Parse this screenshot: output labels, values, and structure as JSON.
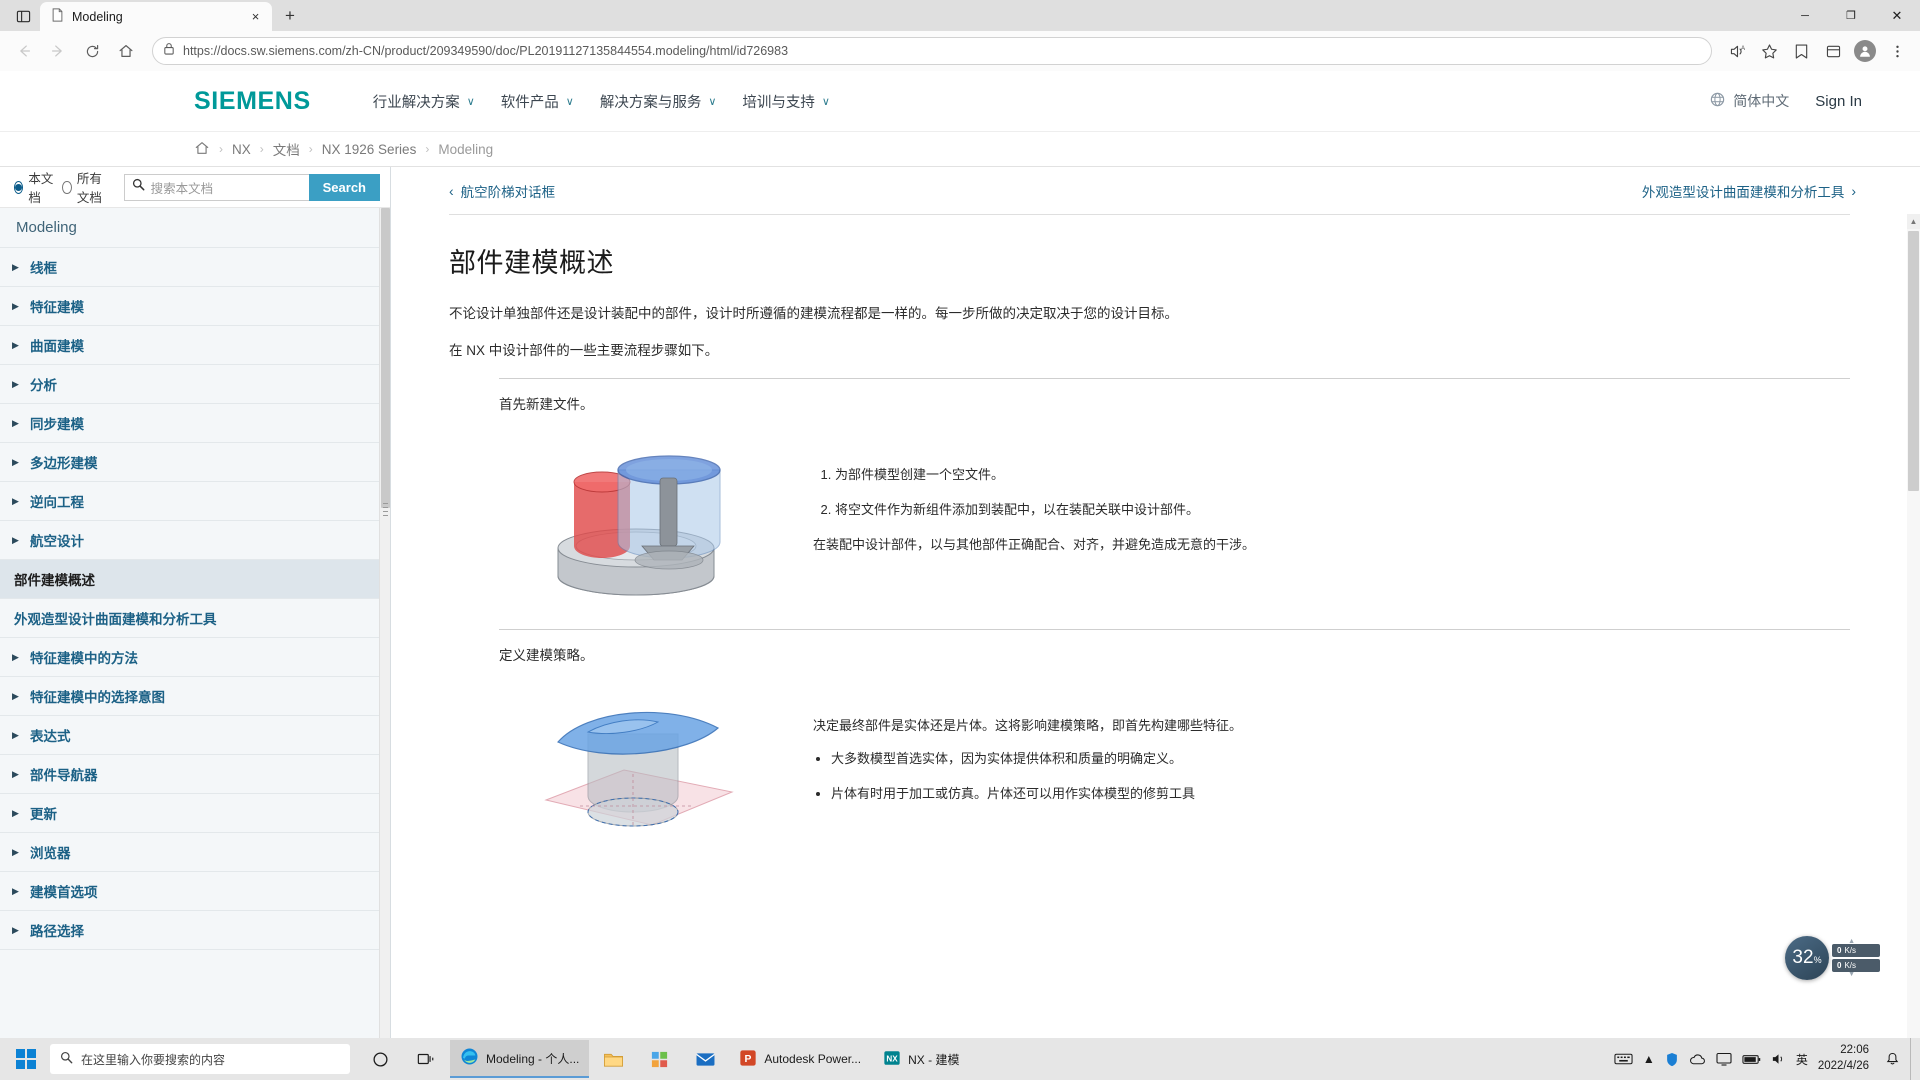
{
  "browser": {
    "tab": {
      "title": "Modeling",
      "close_label": "×",
      "favicon": "page-icon"
    },
    "newtab_label": "+",
    "window_controls": {
      "minimize": "─",
      "maximize": "❐",
      "close": "✕"
    },
    "nav": {
      "back": "←",
      "forward": "→",
      "reload": "↻",
      "home": "⌂"
    },
    "address": {
      "lock_icon": "lock-icon",
      "url_prefix": "https://",
      "url_domain": "docs.sw.siemens.com",
      "url_path": "/zh-CN/product/209349590/doc/PL20191127135844554.modeling/html/id726983",
      "url_full": "https://docs.sw.siemens.com/zh-CN/product/209349590/doc/PL20191127135844554.modeling/html/id726983"
    },
    "toolbar_icons": [
      "read-aloud-icon",
      "favorite-star-icon",
      "favorites-icon",
      "collections-icon",
      "profile-avatar-icon"
    ]
  },
  "site_header": {
    "logo": "SIEMENS",
    "nav": [
      {
        "label": "行业解决方案",
        "caret": "∨"
      },
      {
        "label": "软件产品",
        "caret": "∨"
      },
      {
        "label": "解决方案与服务",
        "caret": "∨"
      },
      {
        "label": "培训与支持",
        "caret": "∨"
      }
    ],
    "language": "简体中文",
    "sign_in": "Sign In"
  },
  "breadcrumb": {
    "home_icon": "home-icon",
    "separator": "›",
    "items": [
      "NX",
      "文档",
      "NX 1926 Series",
      "Modeling"
    ]
  },
  "search_panel": {
    "scope_current": "本文档",
    "scope_all": "所有文档",
    "scope_selected": "本文档",
    "input_value": "",
    "placeholder": "搜索本文档",
    "button_label": "Search",
    "search_icon": "search-icon",
    "accent_color": "#3b9fc4"
  },
  "toc": {
    "heading": "Modeling",
    "items": [
      {
        "label": "线框",
        "expandable": true,
        "active": false
      },
      {
        "label": "特征建模",
        "expandable": true,
        "active": false
      },
      {
        "label": "曲面建模",
        "expandable": true,
        "active": false
      },
      {
        "label": "分析",
        "expandable": true,
        "active": false
      },
      {
        "label": "同步建模",
        "expandable": true,
        "active": false
      },
      {
        "label": "多边形建模",
        "expandable": true,
        "active": false
      },
      {
        "label": "逆向工程",
        "expandable": true,
        "active": false
      },
      {
        "label": "航空设计",
        "expandable": true,
        "active": false
      },
      {
        "label": "部件建模概述",
        "expandable": false,
        "active": true
      },
      {
        "label": "外观造型设计曲面建模和分析工具",
        "expandable": false,
        "active": false
      },
      {
        "label": "特征建模中的方法",
        "expandable": true,
        "active": false
      },
      {
        "label": "特征建模中的选择意图",
        "expandable": true,
        "active": false
      },
      {
        "label": "表达式",
        "expandable": true,
        "active": false
      },
      {
        "label": "部件导航器",
        "expandable": true,
        "active": false
      },
      {
        "label": "更新",
        "expandable": true,
        "active": false
      },
      {
        "label": "浏览器",
        "expandable": true,
        "active": false
      },
      {
        "label": "建模首选项",
        "expandable": true,
        "active": false
      },
      {
        "label": "路径选择",
        "expandable": true,
        "active": false
      }
    ],
    "arrow_glyph": "▶"
  },
  "topic_nav": {
    "prev_chevron": "‹",
    "prev_label": "航空阶梯对话框",
    "next_label": "外观造型设计曲面建模和分析工具",
    "next_chevron": "›"
  },
  "article": {
    "title": "部件建模概述",
    "intro_1": "不论设计单独部件还是设计装配中的部件，设计时所遵循的建模流程都是一样的。每一步所做的决定取决于您的设计目标。",
    "intro_2": "在 NX 中设计部件的一些主要流程步骤如下。",
    "steps": [
      {
        "caption": "首先新建文件。",
        "figure": "assembly-render-figure",
        "ordered": [
          "为部件模型创建一个空文件。",
          "将空文件作为新组件添加到装配中，以在装配关联中设计部件。"
        ],
        "note": "在装配中设计部件，以与其他部件正确配合、对齐，并避免造成无意的干涉。",
        "bullets": []
      },
      {
        "caption": "定义建模策略。",
        "figure": "surface-sheet-figure",
        "ordered": [],
        "note": "决定最终部件是实体还是片体。这将影响建模策略，即首先构建哪些特征。",
        "bullets": [
          "大多数模型首选实体，因为实体提供体积和质量的明确定义。",
          "片体有时用于加工或仿真。片体还可以用作实体模型的修剪工具"
        ]
      }
    ]
  },
  "speed_widget": {
    "value": "32",
    "unit": "%",
    "up_rate": "0",
    "up_unit": "K/s",
    "down_rate": "0",
    "down_unit": "K/s",
    "caret_up": "▲",
    "caret_down": "▼"
  },
  "taskbar": {
    "search_placeholder": "在这里输入你要搜索的内容",
    "search_icon": "search-icon",
    "cortana_icon": "circle-icon",
    "taskview_icon": "task-view-icon",
    "tasks": [
      {
        "label": "Modeling - 个人...",
        "icon": "edge-icon",
        "active": true
      },
      {
        "label": "",
        "icon": "file-explorer-icon",
        "active": false
      },
      {
        "label": "",
        "icon": "store-icon",
        "active": false
      },
      {
        "label": "",
        "icon": "mail-icon",
        "active": false
      },
      {
        "label": "Autodesk Power...",
        "icon": "powermill-icon",
        "active": false
      },
      {
        "label": "NX - 建模",
        "icon": "nx-icon",
        "active": false
      }
    ],
    "tray": [
      "keyboard-icon",
      "chevron-up-icon",
      "shield-icon",
      "cloud-icon",
      "monitor-icon",
      "battery-icon",
      "speaker-icon"
    ],
    "ime": "英",
    "clock_time": "22:06",
    "clock_date": "2022/4/26"
  }
}
